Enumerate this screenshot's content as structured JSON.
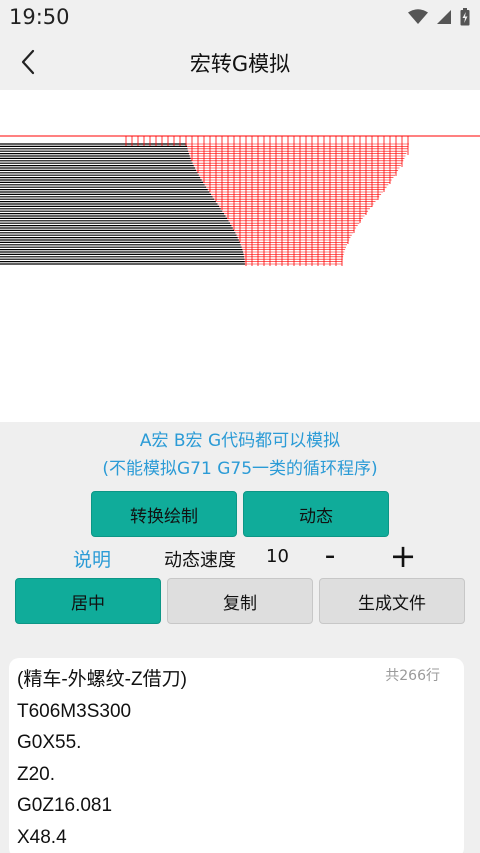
{
  "status": {
    "time": "19:50",
    "icons": [
      "wifi-icon",
      "signal-icon",
      "battery-icon"
    ]
  },
  "header": {
    "title": "宏转G模拟",
    "back_icon": "chevron-left-icon"
  },
  "hints": {
    "line1": "A宏 B宏 G代码都可以模拟",
    "line2": "(不能模拟G71 G75一类的循环程序)"
  },
  "buttons": {
    "convert": "转换绘制",
    "animate": "动态",
    "center": "居中",
    "copy": "复制",
    "generate_file": "生成文件"
  },
  "speed": {
    "explain_link": "说明",
    "label": "动态速度",
    "value": "10",
    "minus": "-",
    "plus": "+"
  },
  "code": {
    "line_count": "共266行",
    "lines": [
      "(精车-外螺纹-Z借刀)",
      "T606M3S300",
      "G0X55.",
      "Z20.",
      "G0Z16.081",
      "X48.4"
    ]
  },
  "colors": {
    "accent": "#10ac9a",
    "link": "#2b9bd6",
    "toolpath_rapid": "#ff0000",
    "toolpath_cut": "#000000"
  }
}
